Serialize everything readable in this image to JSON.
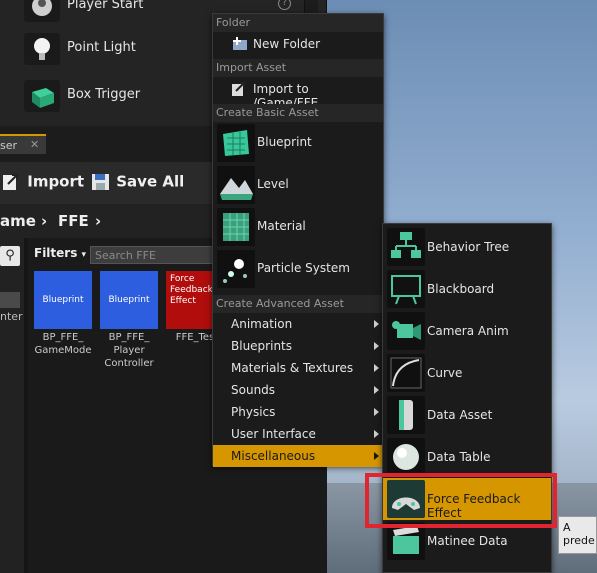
{
  "place_panel": {
    "items": [
      {
        "label": "Player Start",
        "icon": "player-start-icon"
      },
      {
        "label": "Point Light",
        "icon": "light-bulb-icon"
      },
      {
        "label": "Box Trigger",
        "icon": "box-trigger-icon"
      }
    ],
    "help_glyph": "?"
  },
  "content_browser": {
    "tab_label": "ser",
    "tab_close": "✕",
    "toolbar": {
      "import_label": "Import",
      "save_all_label": "Save All"
    },
    "path": {
      "crumb1": "ame",
      "sep1": "›",
      "crumb2": "FFE",
      "sep2": "›"
    },
    "sources_partial_label": "nter",
    "filters_label": "Filters",
    "filters_arrow": "▾",
    "search_placeholder": "Search FFE",
    "assets": [
      {
        "tile_text": "Blueprint",
        "name": "BP_FFE_ GameMode",
        "color": "#2e5ee0"
      },
      {
        "tile_text": "Blueprint",
        "name": "BP_FFE_ Player Controller",
        "color": "#2e5ee0"
      },
      {
        "tile_text": "Force Feedback Effect",
        "name": "FFE_Tes",
        "color": "#b10d0d"
      }
    ]
  },
  "context_menu": {
    "sections": {
      "folder": "Folder",
      "import_asset": "Import Asset",
      "create_basic": "Create Basic Asset",
      "create_advanced": "Create Advanced Asset"
    },
    "new_folder": "New Folder",
    "import_to": "Import to /Game/FFE...",
    "basic_assets": [
      "Blueprint",
      "Level",
      "Material",
      "Particle System"
    ],
    "advanced_categories": [
      "Animation",
      "Blueprints",
      "Materials & Textures",
      "Sounds",
      "Physics",
      "User Interface",
      "Miscellaneous"
    ],
    "selected_category": "Miscellaneous"
  },
  "submenu": {
    "items": [
      "Behavior Tree",
      "Blackboard",
      "Camera Anim",
      "Curve",
      "Data Asset",
      "Data Table",
      "Force Feedback Effect",
      "Matinee Data"
    ],
    "selected": "Force Feedback Effect"
  },
  "tooltip": {
    "text": "A prede"
  },
  "colors": {
    "accent": "#d59600",
    "highlight_border": "#e02430",
    "blueprint_tile": "#2e5ee0",
    "ffe_tile": "#b10d0d"
  }
}
